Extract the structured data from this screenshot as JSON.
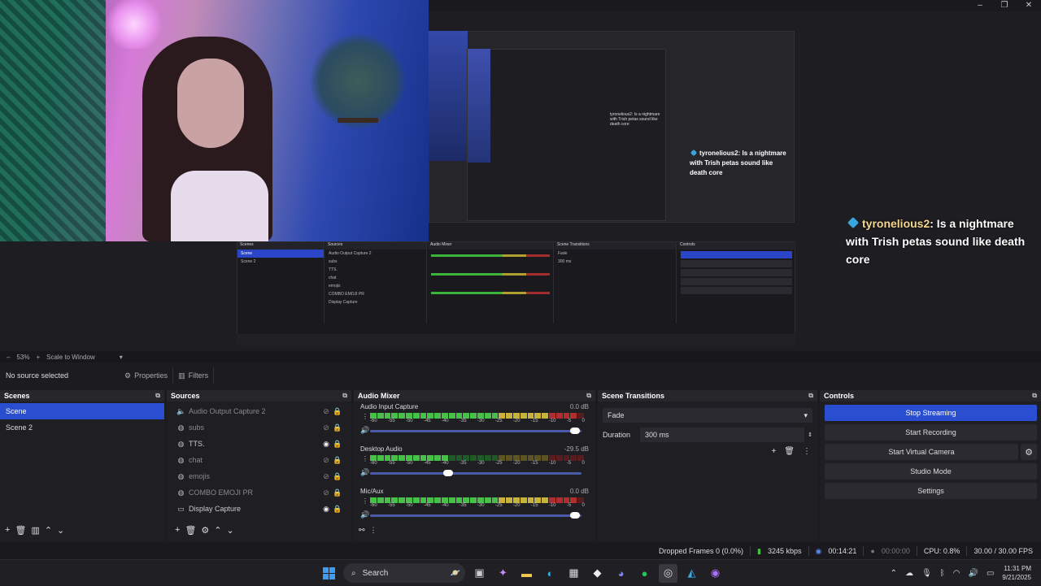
{
  "window": {
    "controls": [
      "–",
      "❐",
      "✕"
    ]
  },
  "preview": {
    "chat": {
      "username": "tyronelious2",
      "message": ": Is a nightmare with Trish petas sound like death core"
    },
    "nested_chat": {
      "username": "tyronelious2",
      "message": ": Is a nightmare with Trish petas sound like death core"
    }
  },
  "zoom": {
    "minus": "–",
    "level": "53%",
    "plus": "+",
    "mode": "Scale to Window"
  },
  "source_toolbar": {
    "no_source": "No source selected",
    "properties": "Properties",
    "filters": "Filters"
  },
  "scenes": {
    "title": "Scenes",
    "items": [
      {
        "label": "Scene",
        "selected": true
      },
      {
        "label": "Scene 2",
        "selected": false
      }
    ]
  },
  "sources": {
    "title": "Sources",
    "items": [
      {
        "label": "Audio Output Capture 2",
        "icon": "speaker-icon",
        "visible": false
      },
      {
        "label": "subs",
        "icon": "globe-icon",
        "visible": false
      },
      {
        "label": "TTS.",
        "icon": "globe-icon",
        "visible": true
      },
      {
        "label": "chat",
        "icon": "globe-icon",
        "visible": false
      },
      {
        "label": "emojis",
        "icon": "globe-icon",
        "visible": false
      },
      {
        "label": "COMBO EMOJI PR",
        "icon": "globe-icon",
        "visible": false
      },
      {
        "label": "Display Capture",
        "icon": "monitor-icon",
        "visible": true
      }
    ]
  },
  "mixer": {
    "title": "Audio Mixer",
    "scale": [
      "-60",
      "-55",
      "-50",
      "-45",
      "-40",
      "-35",
      "-30",
      "-25",
      "-20",
      "-15",
      "-10",
      "-5",
      "0"
    ],
    "channels": [
      {
        "name": "Audio Input Capture",
        "db": "0.0 dB",
        "level": 0.97
      },
      {
        "name": "Desktop Audio",
        "db": "-29.5 dB",
        "level": 0.37
      },
      {
        "name": "Mic/Aux",
        "db": "0.0 dB",
        "level": 0.97
      }
    ]
  },
  "transitions": {
    "title": "Scene Transitions",
    "selected": "Fade",
    "duration_label": "Duration",
    "duration_value": "300 ms"
  },
  "controls": {
    "title": "Controls",
    "stop_streaming": "Stop Streaming",
    "start_recording": "Start Recording",
    "start_virtual_camera": "Start Virtual Camera",
    "studio_mode": "Studio Mode",
    "settings": "Settings"
  },
  "status": {
    "dropped_frames": "Dropped Frames 0 (0.0%)",
    "bitrate": "3245 kbps",
    "stream_time": "00:14:21",
    "record_time": "00:00:00",
    "cpu": "CPU: 0.8%",
    "fps": "30.00 / 30.00 FPS"
  },
  "taskbar": {
    "search_label": "Search",
    "time": "11:31 PM",
    "date": "9/21/2025"
  },
  "colors": {
    "accent": "#2a4ed0",
    "meter_green": "#46c046",
    "meter_yellow": "#c7b33a",
    "meter_red": "#b02e2e"
  }
}
